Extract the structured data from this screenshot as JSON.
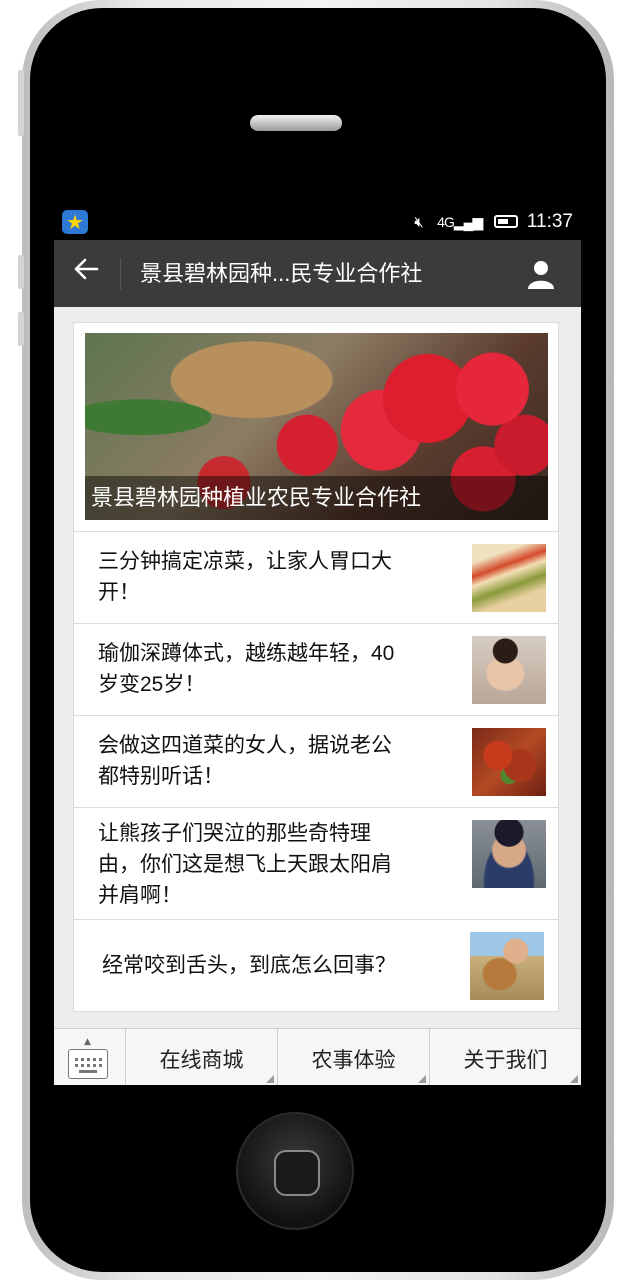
{
  "status_bar": {
    "signal": "4G",
    "time": "11:37"
  },
  "header": {
    "title": "景县碧林园种...民专业合作社"
  },
  "hero": {
    "caption": "景县碧林园种植业农民专业合作社"
  },
  "articles": [
    {
      "title_line1": "三分钟搞定凉菜，让家人胃口大",
      "title_line2": "开！"
    },
    {
      "title_line1": "瑜伽深蹲体式，越练越年轻，40",
      "title_line2": "岁变25岁！"
    },
    {
      "title_line1": "会做这四道菜的女人，据说老公",
      "title_line2": "都特别听话！"
    },
    {
      "title_line1": "让熊孩子们哭泣的那些奇特理",
      "title_line2": "由，你们这是想飞上天跟太阳肩",
      "title_line3": "并肩啊！"
    },
    {
      "title_line1": "经常咬到舌头，到底怎么回事？"
    }
  ],
  "tabbar": {
    "tabs": [
      "在线商城",
      "农事体验",
      "关于我们"
    ]
  },
  "colors": {
    "header_bg": "#3b3b3b",
    "status_bg": "#000000",
    "page_bg": "#ededed"
  }
}
